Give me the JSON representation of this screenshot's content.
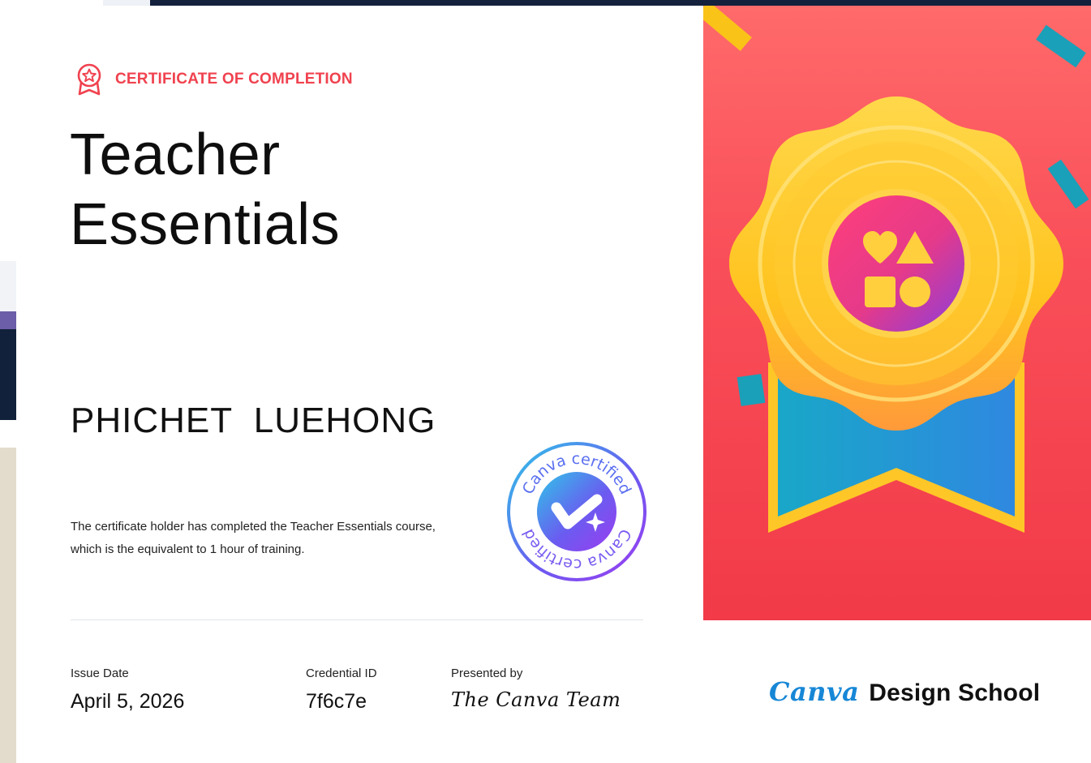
{
  "certificate": {
    "eyebrow": "CERTIFICATE OF COMPLETION",
    "title_line1": "Teacher",
    "title_line2": "Essentials",
    "holder_name": "PHICHET  LUEHONG",
    "description": "The certificate holder has completed the Teacher Essentials course, which is the equivalent to 1 hour of training."
  },
  "meta": {
    "issue_date_label": "Issue Date",
    "issue_date": "April 5, 2026",
    "credential_id_label": "Credential ID",
    "credential_id": "7f6c7e",
    "presented_by_label": "Presented by",
    "presented_by": "The Canva Team"
  },
  "stamp": {
    "top_text": "Canva certified",
    "bottom_text": "Canva certified",
    "icon": "checkmark-sparkle-icon"
  },
  "brand": {
    "logo": "Canva",
    "text": "Design School"
  },
  "medal": {
    "icon": "shapes-heart-triangle-square-circle-icon"
  },
  "colors": {
    "accent": "#f0424f",
    "panel": "#f94f5a",
    "medal_gold": "#ffc21a",
    "ribbon_blue": "#1b9ad6",
    "canva_blue": "#1787d6"
  }
}
